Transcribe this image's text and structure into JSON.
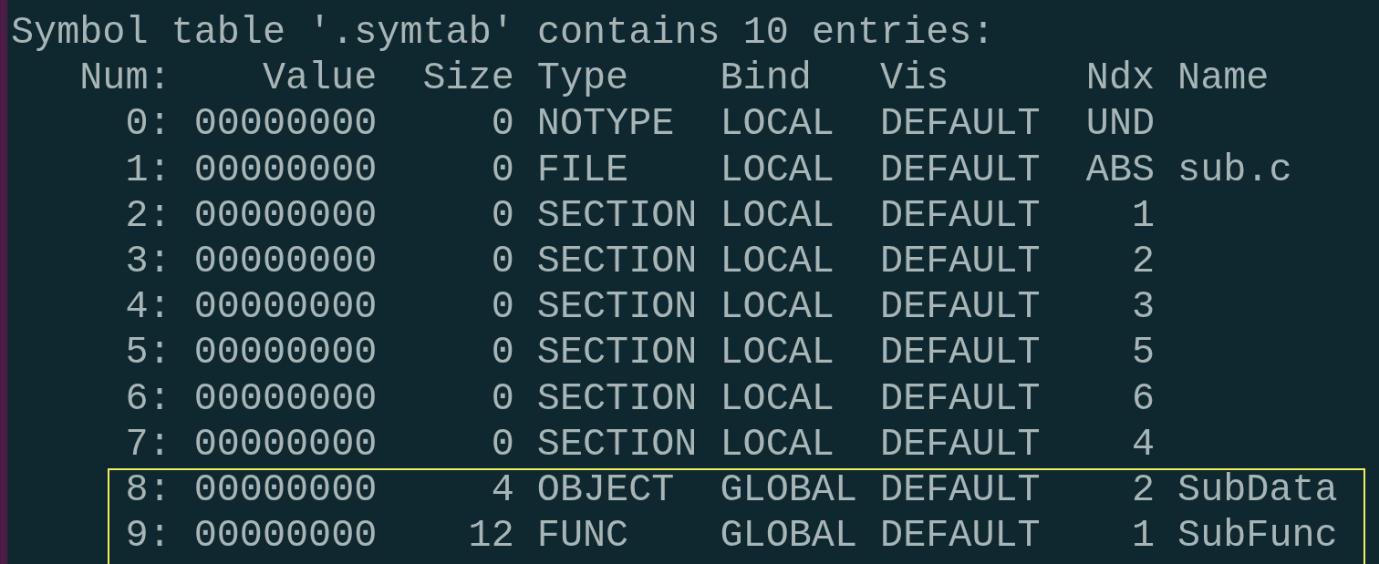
{
  "title": "Symbol table '.symtab' contains 10 entries:",
  "columns": [
    "Num:",
    "Value",
    "Size",
    "Type",
    "Bind",
    "Vis",
    "Ndx",
    "Name"
  ],
  "rows": [
    {
      "num": "0:",
      "value": "00000000",
      "size": "0",
      "type": "NOTYPE",
      "bind": "LOCAL",
      "vis": "DEFAULT",
      "ndx": "UND",
      "highlighted": false
    },
    {
      "num": "1:",
      "value": "00000000",
      "size": "0",
      "type": "FILE",
      "bind": "LOCAL",
      "vis": "DEFAULT",
      "ndx": "ABS",
      "name": "sub.c",
      "highlighted": false
    },
    {
      "num": "2:",
      "value": "00000000",
      "size": "0",
      "type": "SECTION",
      "bind": "LOCAL",
      "vis": "DEFAULT",
      "ndx": "1",
      "highlighted": false
    },
    {
      "num": "3:",
      "value": "00000000",
      "size": "0",
      "type": "SECTION",
      "bind": "LOCAL",
      "vis": "DEFAULT",
      "ndx": "2",
      "highlighted": false
    },
    {
      "num": "4:",
      "value": "00000000",
      "size": "0",
      "type": "SECTION",
      "bind": "LOCAL",
      "vis": "DEFAULT",
      "ndx": "3",
      "highlighted": false
    },
    {
      "num": "5:",
      "value": "00000000",
      "size": "0",
      "type": "SECTION",
      "bind": "LOCAL",
      "vis": "DEFAULT",
      "ndx": "5",
      "highlighted": false
    },
    {
      "num": "6:",
      "value": "00000000",
      "size": "0",
      "type": "SECTION",
      "bind": "LOCAL",
      "vis": "DEFAULT",
      "ndx": "6",
      "highlighted": false
    },
    {
      "num": "7:",
      "value": "00000000",
      "size": "0",
      "type": "SECTION",
      "bind": "LOCAL",
      "vis": "DEFAULT",
      "ndx": "4",
      "highlighted": false
    },
    {
      "num": "8:",
      "value": "00000000",
      "size": "4",
      "type": "OBJECT",
      "bind": "GLOBAL",
      "vis": "DEFAULT",
      "ndx": "2",
      "name": "SubData",
      "highlighted": true
    },
    {
      "num": "9:",
      "value": "00000000",
      "size": "12",
      "type": "FUNC",
      "bind": "GLOBAL",
      "vis": "DEFAULT",
      "ndx": "1",
      "name": "SubFunc",
      "highlighted": true
    }
  ]
}
